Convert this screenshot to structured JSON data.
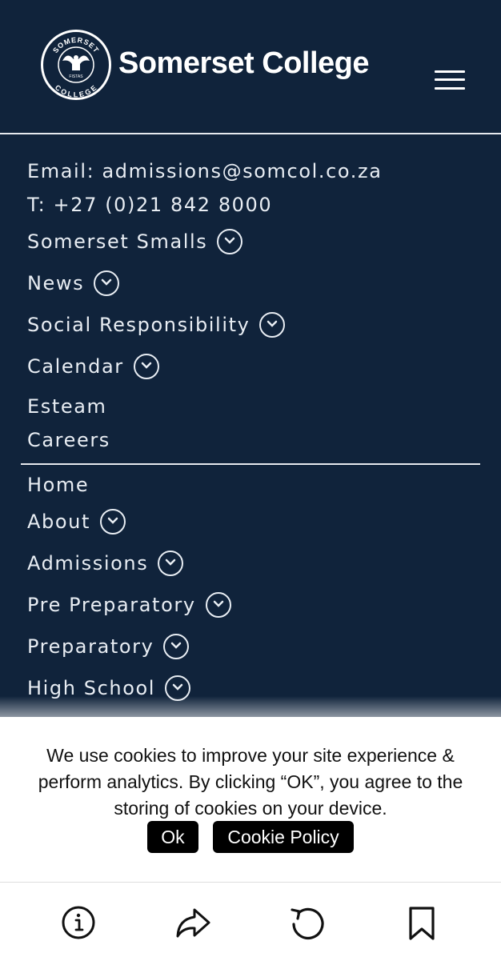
{
  "header": {
    "brand_name": "Somerset College",
    "logo_top_text": "SOMERSET",
    "logo_bottom_text": "COLLEGE",
    "logo_motto": "FISTAS",
    "menu_icon": "hamburger-icon"
  },
  "contact": {
    "email": "Email: admissions@somcol.co.za",
    "phone": "T: +27 (0)21 842 8000"
  },
  "secondary_nav": [
    {
      "label": "Somerset Smalls",
      "has_dropdown": true
    },
    {
      "label": "News",
      "has_dropdown": true
    },
    {
      "label": "Social Responsibility",
      "has_dropdown": true
    },
    {
      "label": "Calendar",
      "has_dropdown": true
    },
    {
      "label": "Esteam",
      "has_dropdown": false
    },
    {
      "label": "Careers",
      "has_dropdown": false
    }
  ],
  "main_nav": [
    {
      "label": "Home",
      "has_dropdown": false
    },
    {
      "label": "About",
      "has_dropdown": true
    },
    {
      "label": "Admissions",
      "has_dropdown": true
    },
    {
      "label": "Pre Preparatory",
      "has_dropdown": true
    },
    {
      "label": "Preparatory",
      "has_dropdown": true
    },
    {
      "label": "High School",
      "has_dropdown": true
    }
  ],
  "cookie_banner": {
    "message": "We use cookies to improve your site experience & perform analytics. By clicking “OK”, you agree to the storing of cookies on your device.",
    "ok_label": "Ok",
    "policy_label": "Cookie Policy"
  },
  "browser_toolbar": {
    "icons": [
      "info-icon",
      "share-icon",
      "reload-icon",
      "bookmark-icon"
    ]
  },
  "colors": {
    "navy": "#10233b",
    "text_light": "#e8edf3",
    "button_bg": "#000000"
  }
}
